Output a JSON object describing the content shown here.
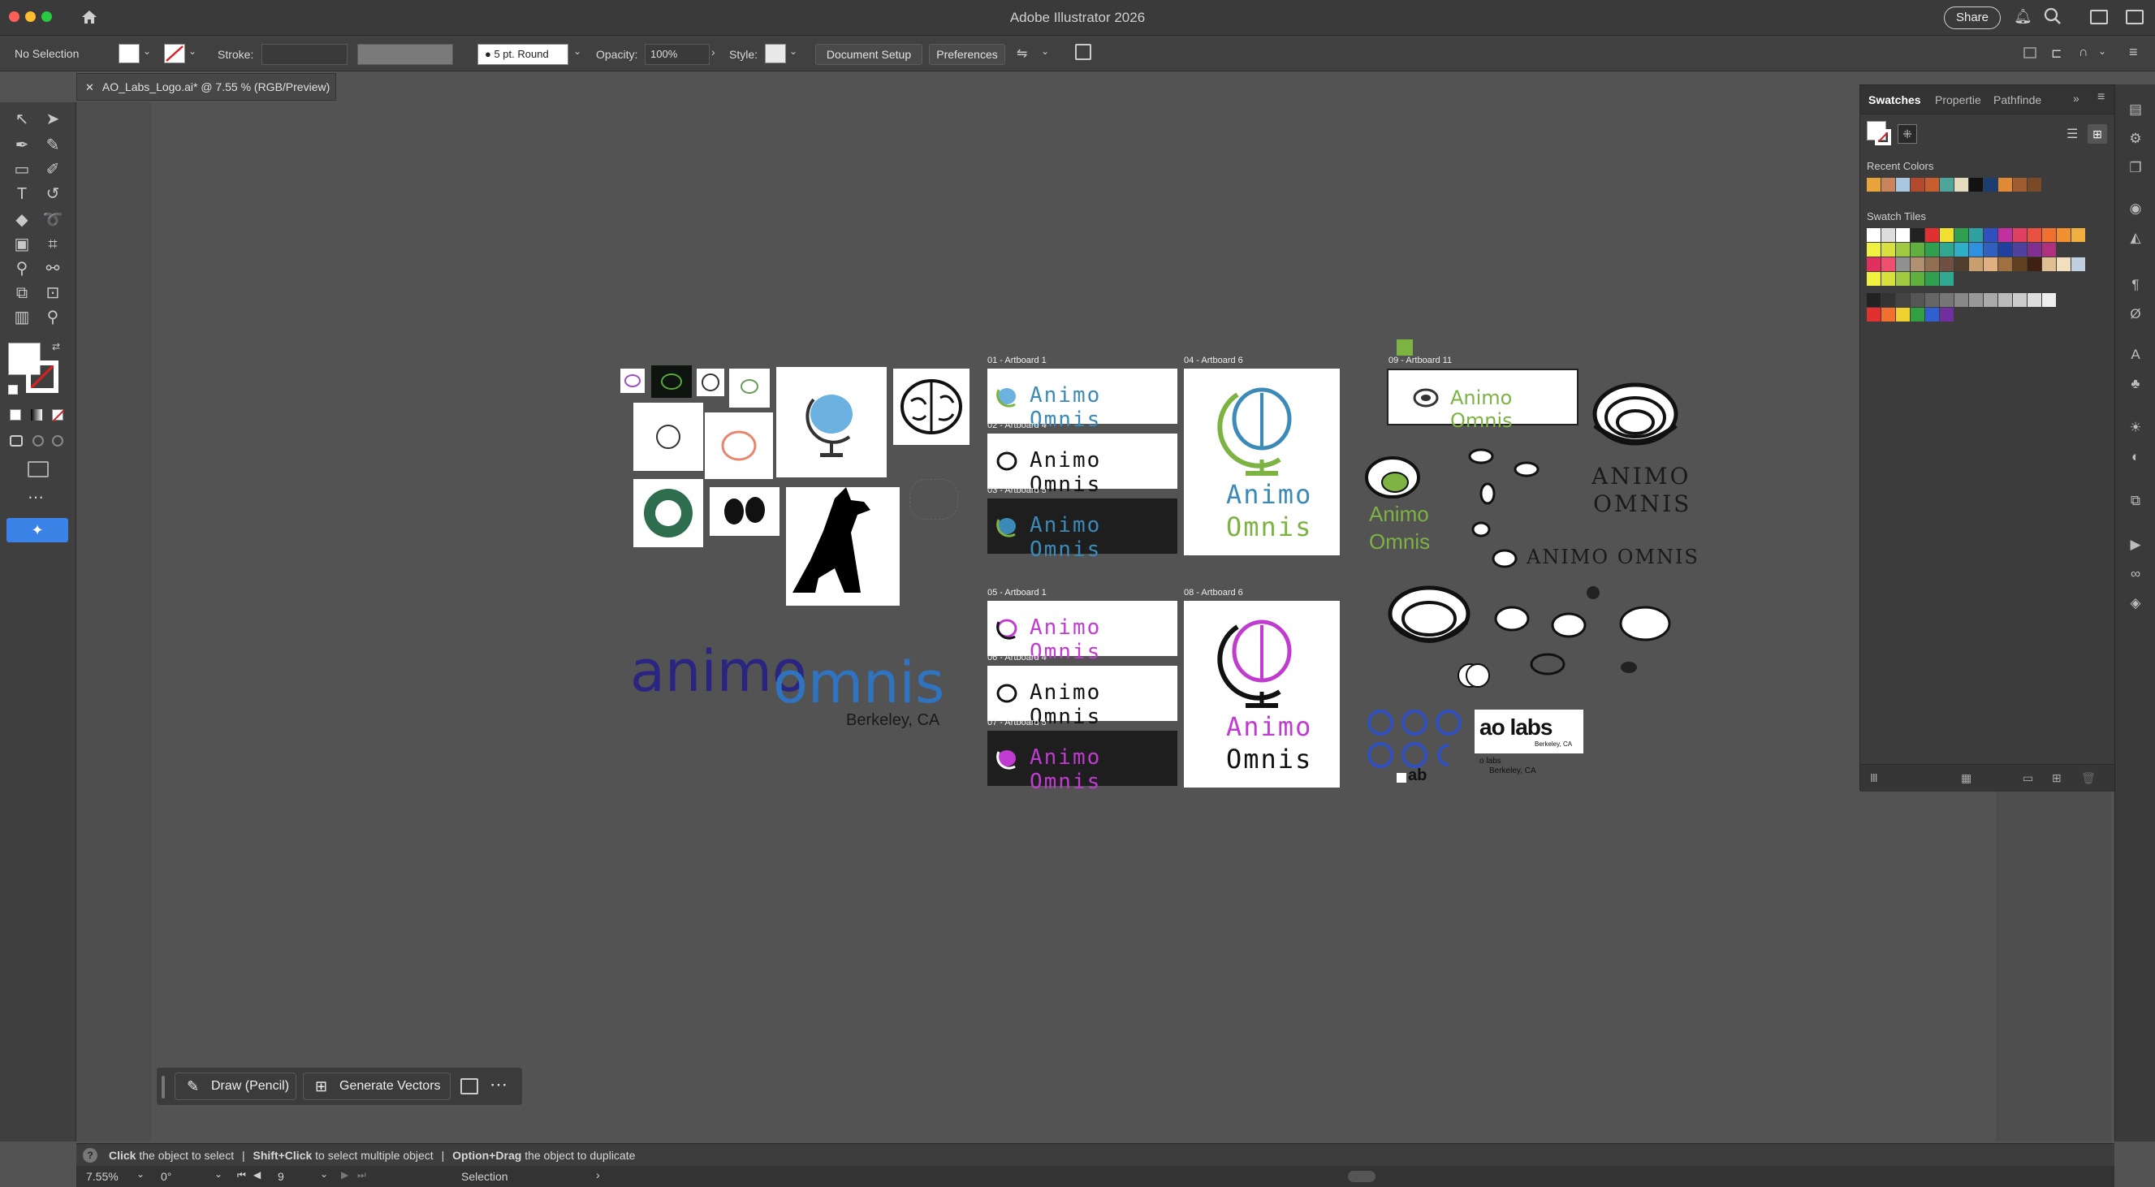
{
  "window": {
    "title": "Adobe Illustrator 2026",
    "share_label": "Share"
  },
  "control_bar": {
    "selection": "No Selection",
    "stroke_label": "Stroke:",
    "brush": "5 pt. Round",
    "opacity_label": "Opacity:",
    "opacity_value": "100%",
    "style_label": "Style:",
    "document_setup": "Document Setup",
    "preferences": "Preferences"
  },
  "document_tab": {
    "label": "AO_Labs_Logo.ai* @ 7.55 % (RGB/Preview)"
  },
  "swatches_panel": {
    "tabs": [
      "Swatches",
      "Propertie",
      "Pathfinde"
    ],
    "recent_colors_label": "Recent Colors",
    "swatch_tiles_label": "Swatch Tiles",
    "recent_colors": [
      "#e8a33a",
      "#c9845a",
      "#a9c7df",
      "#b34a2d",
      "#c85e30",
      "#4da59b",
      "#e5dcc0",
      "#121212",
      "#1b3d70",
      "#e08a35",
      "#a05c2e",
      "#7a4a28"
    ],
    "tiles_row1": [
      "#ffffff",
      "#dddddd",
      "#ffffff",
      "#222222",
      "#e03030",
      "#f0e030",
      "#30a050",
      "#30a0a0",
      "#3050c0",
      "#c030a0",
      "#e04060",
      "#e85040",
      "#f07030",
      "#f09030",
      "#f0b040"
    ],
    "tiles_row2": [
      "#f0f040",
      "#d8e040",
      "#a0c840",
      "#60b040",
      "#30a050",
      "#30a890",
      "#30b0c8",
      "#3090e0",
      "#3060c0",
      "#2040a0",
      "#5040a0",
      "#803090",
      "#b03080"
    ],
    "tiles_row3": [
      "#e03060",
      "#f05070",
      "#909090",
      "#b09070",
      "#907050",
      "#705040",
      "#504030",
      "#c8a070",
      "#e0b080",
      "#a07040",
      "#604020",
      "#402010",
      "#e0c090",
      "#f0e0c0",
      "#c0d0e0"
    ],
    "grays": [
      "#222222",
      "#333333",
      "#444444",
      "#555555",
      "#666666",
      "#777777",
      "#888888",
      "#999999",
      "#aaaaaa",
      "#bbbbbb",
      "#cccccc",
      "#dddddd",
      "#eeeeee"
    ],
    "bright": [
      "#e03030",
      "#f07030",
      "#f0d030",
      "#30a040",
      "#3060d0",
      "#7030a0"
    ]
  },
  "context_bar": {
    "draw_pencil": "Draw (Pencil)",
    "generate_vectors": "Generate Vectors"
  },
  "status": {
    "click": "Click",
    "click_text": "the object to select",
    "shift_click": "Shift+Click",
    "shift_text": "to select multiple object",
    "option_drag": "Option+Drag",
    "option_text": "the object to duplicate"
  },
  "bottom_bar": {
    "zoom": "7.55%",
    "rotate": "0°",
    "artboard_num": "9",
    "tool": "Selection"
  },
  "artboards": {
    "ab01": "01 - Artboard 1",
    "ab02": "02 - Artboard 4",
    "ab03": "03 - Artboard 5",
    "ab04": "04 - Artboard 6",
    "ab05": "05 - Artboard 1",
    "ab06": "06 - Artboard 4",
    "ab07": "07 - Artboard 5",
    "ab08": "08 - Artboard 6",
    "ab09": "09 - Artboard 11"
  },
  "canvas_text": {
    "animo_omnis_caps": "ANIMO OMNIS",
    "animo": "Animo",
    "omnis": "Omnis",
    "animo_omnis_mixed": "Animo Omnis",
    "wordmark_animo": "animo",
    "wordmark_omnis": "omnis",
    "berkeley": "Berkeley, CA",
    "aolabs": "ao labs",
    "aolabs_small": "o labs",
    "berkeley_small": "Berkeley, CA",
    "ab": "ab",
    "animo_caps": "ANIMO",
    "omnis_caps": "OMNIS"
  }
}
